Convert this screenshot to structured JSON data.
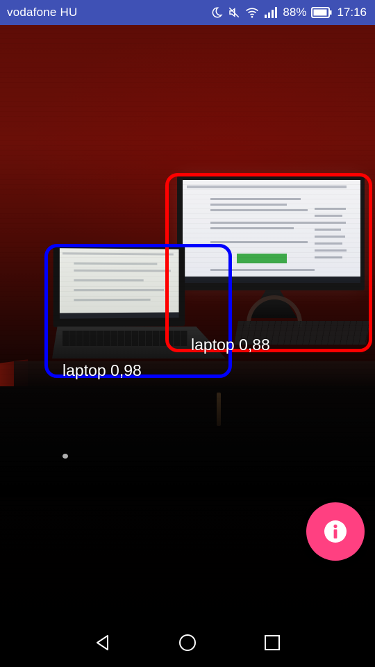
{
  "status_bar": {
    "carrier": "vodafone HU",
    "battery_percent": "88%",
    "time": "17:16",
    "icons": [
      "moon-icon",
      "mute-icon",
      "wifi-icon",
      "signal-icon",
      "battery-icon"
    ],
    "background_color": "#3f51b5"
  },
  "detections": [
    {
      "label": "laptop 0,88",
      "color": "#ff0000"
    },
    {
      "label": "laptop 0,98",
      "color": "#0000ff"
    }
  ],
  "fab": {
    "icon": "info-icon",
    "color": "#ff4081"
  },
  "nav_bar": {
    "buttons": [
      "back-icon",
      "home-icon",
      "recents-icon"
    ]
  }
}
